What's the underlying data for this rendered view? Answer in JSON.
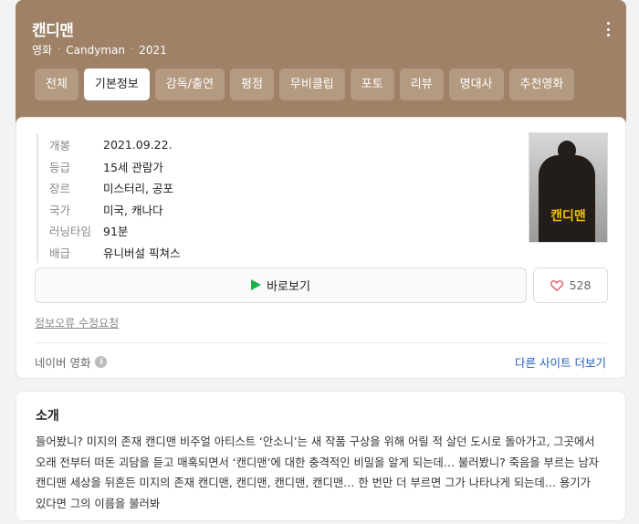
{
  "movie": {
    "title": "캔디맨",
    "category": "영화",
    "original_title": "Candyman",
    "year": "2021"
  },
  "tabs": [
    {
      "label": "전체",
      "active": false
    },
    {
      "label": "기본정보",
      "active": true
    },
    {
      "label": "감독/출연",
      "active": false
    },
    {
      "label": "평점",
      "active": false
    },
    {
      "label": "무비클립",
      "active": false
    },
    {
      "label": "포토",
      "active": false
    },
    {
      "label": "리뷰",
      "active": false
    },
    {
      "label": "명대사",
      "active": false
    },
    {
      "label": "추천영화",
      "active": false
    }
  ],
  "info": {
    "release_label": "개봉",
    "release_value": "2021.09.22.",
    "rating_label": "등급",
    "rating_value": "15세 관람가",
    "genre_label": "장르",
    "genre_value": "미스터리, 공포",
    "country_label": "국가",
    "country_value": "미국, 캐나다",
    "runtime_label": "러닝타임",
    "runtime_value": "91분",
    "distributor_label": "배급",
    "distributor_value": "유니버설 픽쳐스"
  },
  "poster": {
    "title_text": "캔디맨"
  },
  "actions": {
    "watch_label": "바로보기",
    "like_count": "528"
  },
  "report_link": "정보오류 수정요청",
  "source": {
    "label": "네이버 영화",
    "other_sites": "다른 사이트 더보기"
  },
  "intro": {
    "title": "소개",
    "text": "들어봤니? 미지의 존재 캔디맨 비주얼 아티스트 ‘안소니’는 새 작품 구상을 위해 어릴 적 살던 도시로 돌아가고, 그곳에서 오래 전부터 떠돈 괴담을 듣고 매혹되면서 ‘캔디맨’에 대한 충격적인 비밀을 알게 되는데… 불러봤니? 죽음을 부르는 남자 캔디맨 세상을 뒤흔든 미지의 존재 캔디맨, 캔디맨, 캔디맨, 캔디맨… 한 번만 더 부르면 그가 나타나게 되는데… 용기가 있다면 그의 이름을 불러봐"
  },
  "colors": {
    "header_bg": "#9e8166",
    "tab_bg": "#b39a80",
    "link": "#1f5fb4",
    "play": "#18b24a",
    "heart": "#e0515e"
  }
}
